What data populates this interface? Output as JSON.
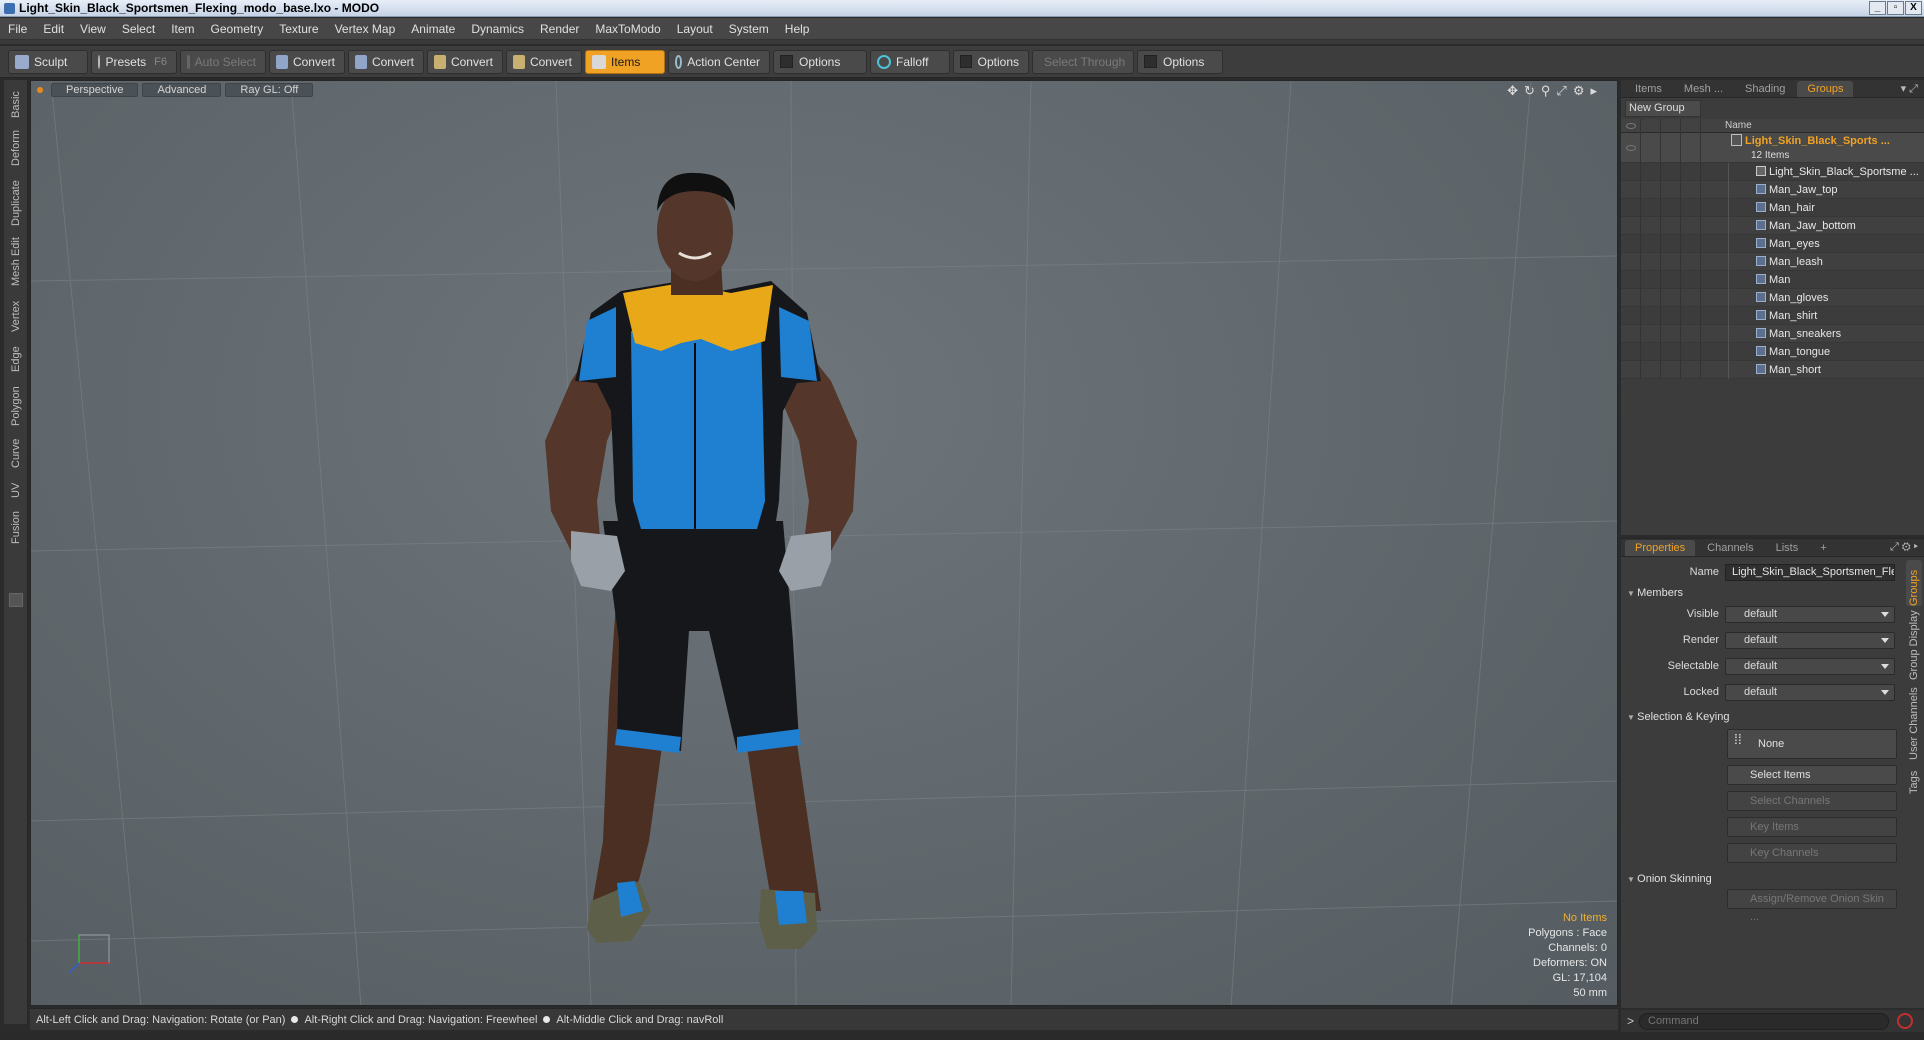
{
  "window": {
    "title": "Light_Skin_Black_Sportsmen_Flexing_modo_base.lxo - MODO",
    "controls": [
      "_",
      "▫",
      "X"
    ]
  },
  "menu": [
    "File",
    "Edit",
    "View",
    "Select",
    "Item",
    "Geometry",
    "Texture",
    "Vertex Map",
    "Animate",
    "Dynamics",
    "Render",
    "MaxToModo",
    "Layout",
    "System",
    "Help"
  ],
  "toolbar": {
    "sculpt": "Sculpt",
    "presets": "Presets",
    "presets_key": "F6",
    "auto_select": "Auto Select",
    "convert": "Convert",
    "items": "Items",
    "action_center": "Action Center",
    "options": "Options",
    "falloff": "Falloff",
    "select_through": "Select Through"
  },
  "left_tabs": [
    "Basic",
    "Deform",
    "Duplicate",
    "Mesh Edit",
    "Vertex",
    "Edge",
    "Polygon",
    "Curve",
    "UV",
    "Fusion"
  ],
  "viewport": {
    "view": "Perspective",
    "shading": "Advanced",
    "raygl": "Ray GL: Off",
    "hud": {
      "selection": "No Items",
      "polygons": "Polygons : Face",
      "channels": "Channels: 0",
      "deformers": "Deformers: ON",
      "gl": "GL: 17,104",
      "focal": "50 mm"
    }
  },
  "status": {
    "hint1": "Alt-Left Click and Drag: Navigation: Rotate (or Pan)",
    "hint2": "Alt-Right Click and Drag: Navigation: Freewheel",
    "hint3": "Alt-Middle Click and Drag: navRoll"
  },
  "groups_panel": {
    "tabs": [
      "Items",
      "Mesh ...",
      "Shading",
      "Groups"
    ],
    "active_tab": "Groups",
    "new_group": "New Group",
    "col_name": "Name",
    "group_name": "Light_Skin_Black_Sports ...",
    "group_count": "12 Items",
    "items": [
      "Light_Skin_Black_Sportsme ...",
      "Man_Jaw_top",
      "Man_hair",
      "Man_Jaw_bottom",
      "Man_eyes",
      "Man_leash",
      "Man",
      "Man_gloves",
      "Man_shirt",
      "Man_sneakers",
      "Man_tongue",
      "Man_short"
    ]
  },
  "properties": {
    "tabs": [
      "Properties",
      "Channels",
      "Lists",
      "+"
    ],
    "name_label": "Name",
    "name_value": "Light_Skin_Black_Sportsmen_Fle",
    "members": "Members",
    "visible_label": "Visible",
    "render_label": "Render",
    "selectable_label": "Selectable",
    "locked_label": "Locked",
    "default": "default",
    "sel_keying": "Selection & Keying",
    "none": "None",
    "select_items": "Select Items",
    "select_channels": "Select Channels",
    "key_items": "Key Items",
    "key_channels": "Key Channels",
    "onion": "Onion Skinning",
    "assign_onion": "Assign/Remove Onion Skin ...",
    "side_tabs": [
      "Groups",
      "Group Display",
      "User Channels",
      "Tags"
    ]
  },
  "command": {
    "placeholder": "Command",
    "prompt": ">"
  },
  "colors": {
    "accent": "#f0a224",
    "shirt_blue": "#1f7fd0",
    "shirt_yellow": "#e8a818"
  }
}
